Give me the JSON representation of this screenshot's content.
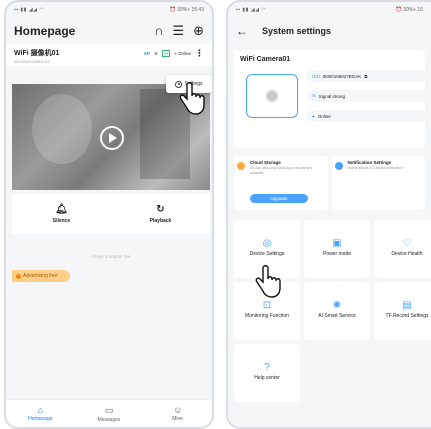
{
  "left": {
    "status_time": "⏰ 30%+ 15:43",
    "header": {
      "title": "Homepage"
    },
    "camera": {
      "name": "WiFi 摄像机01",
      "uid": "0KC0S0S2254KJ2Z",
      "ap": "AP",
      "battery": "99",
      "status": "Online"
    },
    "popup": {
      "settings_label": "Settings"
    },
    "actions": {
      "silence": "Silence",
      "playback": "Playback"
    },
    "bottom_line": "I have a bottom line",
    "ad_free": "Advertising free",
    "nav": {
      "home": "Homepage",
      "messages": "Messages",
      "mine": "Mine"
    }
  },
  "right": {
    "status_time": "⏰ 30%+ 15",
    "header": {
      "title": "System settings"
    },
    "device": {
      "name": "WiFi Camera01",
      "uid_label": "UID",
      "uid_value": "0KB0158027BGAK",
      "signal": "Signal strong",
      "status": "Online"
    },
    "cloud": {
      "title": "Cloud Storage",
      "subtitle": "30-day ultra-long cloud loop recording is available",
      "button": "Upgrade"
    },
    "notification": {
      "title": "Notification Settings",
      "subtitle": "Mobile phone & Camera notification"
    },
    "tiles": [
      {
        "label": "Device Settings"
      },
      {
        "label": "Power mode"
      },
      {
        "label": "Device Health"
      },
      {
        "label": "Monitoring Function"
      },
      {
        "label": "AI Smart Service"
      },
      {
        "label": "TF Record Settings"
      },
      {
        "label": "Help center"
      }
    ]
  },
  "colors": {
    "accent": "#4aa3ff",
    "online": "#36c45b",
    "ad": "#ffcf8a"
  }
}
